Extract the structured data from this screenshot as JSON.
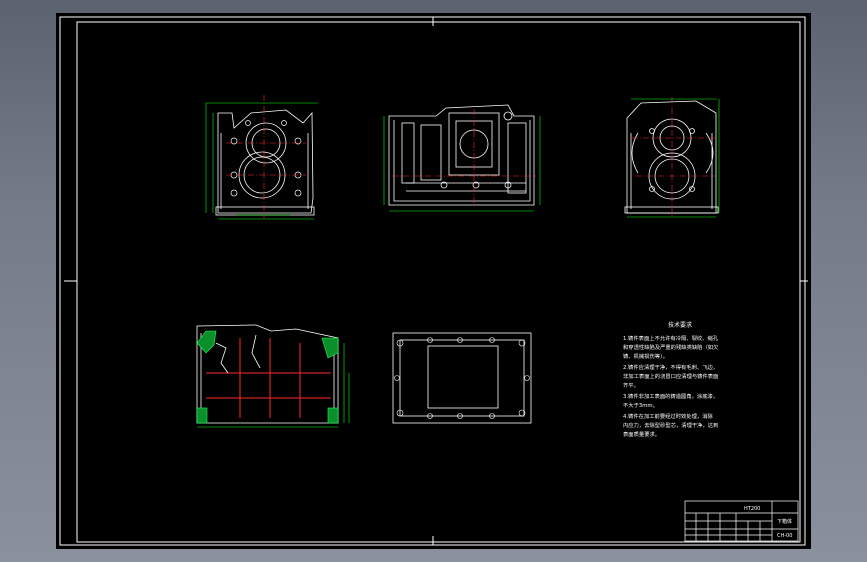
{
  "drawing": {
    "technical_requirements": {
      "title": "技术要求",
      "lines": [
        "1.铸件表面上不允许有冷隔、裂纹、缩孔",
        "和穿透性缺陷及严重的残缺类缺陷（如欠",
        "铸、机械损伤等）。",
        "2.铸件应清理干净，不得有毛刺、飞边，",
        "非加工表面上的浇冒口应清理与铸件表面",
        "齐平。",
        "3.铸件非加工表面的铸造圆角，涂底漆，",
        "不大于3mm。",
        "4.铸件在加工前要经过时效处理，消除",
        "内应力，去除型砂型芯，清理干净，达到",
        "表面质量要求。"
      ]
    },
    "title_block": {
      "part_name": "下箱体",
      "drawing_number": "CH-00",
      "material": "HT200"
    },
    "colors": {
      "background": "#000000",
      "line": "#ffffff",
      "centerline": "#ff2a2a",
      "dimension": "#00ff00"
    }
  }
}
